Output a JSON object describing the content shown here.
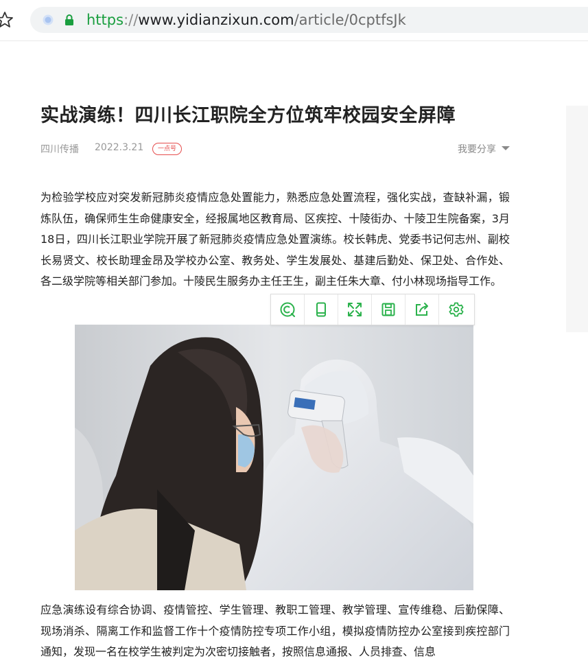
{
  "browser": {
    "url_scheme": "https",
    "url_separator": "://",
    "url_host": "www.yidianzixun.com",
    "url_path": "/article/0cptfsJk",
    "bookmark_icon": "star-icon",
    "security_icon": "lock-icon"
  },
  "article": {
    "title": "实战演练！四川长江职院全方位筑牢校园安全屏障",
    "source": "四川传播",
    "date": "2022.3.21",
    "badge": "一点号",
    "share_label": "我要分享",
    "paragraph_1": "为检验学校应对突发新冠肺炎疫情应急处置能力，熟悉应急处置流程，强化实战，查缺补漏，锻炼队伍，确保师生生命健康安全，经报属地区教育局、区疾控、十陵街办、十陵卫生院备案，3月18日，四川长江职业学院开展了新冠肺炎疫情应急处置演练。校长韩虎、党委书记何志州、副校长易贤文、校长助理金昂及学校办公室、教务处、学生发展处、基建后勤处、保卫处、合作处、各二级学院等相关部门参加。十陵民生服务办主任王生，副主任朱大章、付小林现场指导工作。",
    "paragraph_2": "应急演练设有综合协调、疫情管控、学生管理、教职工管理、教学管理、宣传维稳、后勤保障、现场消杀、隔离工作和监督工作十个疫情防控专项工作小组，模拟疫情防控办公室接到疾控部门通知，发现一名在校学生被判定为次密切接触者，按照信息通报、人员排查、信息"
  },
  "toolbar": {
    "icons": [
      "search-text-icon",
      "phone-icon",
      "fullscreen-icon",
      "save-icon",
      "share-icon",
      "settings-icon"
    ],
    "accent": "#2bb24c"
  },
  "colors": {
    "url_scheme": "#1a9e3f",
    "badge": "#e54c4c",
    "title": "#222222",
    "meta": "#999999"
  }
}
